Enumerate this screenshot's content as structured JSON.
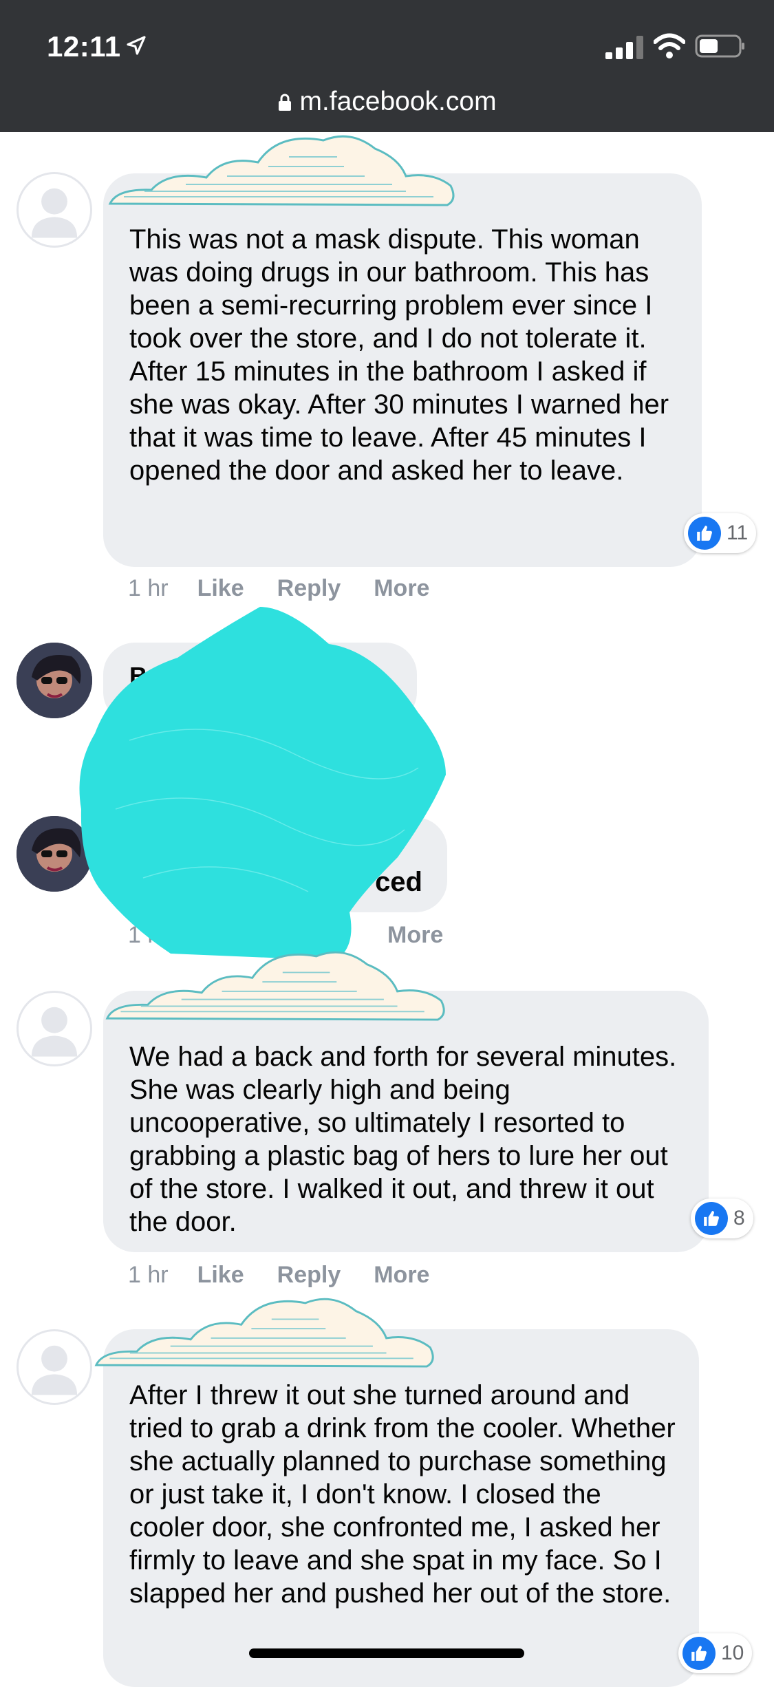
{
  "status_bar": {
    "time": "12:11"
  },
  "browser": {
    "url": "m.facebook.com"
  },
  "comments": [
    {
      "text": "This was not a mask dispute. This woman was doing drugs in our bathroom. This has been a semi-recurring problem ever since I took over the store, and I do not tolerate it. After 15 minutes in the bathroom I asked if she was okay. After 30 minutes I warned her that it was time to leave. After 45 minutes I opened the door and asked her to leave.",
      "time": "1 hr",
      "like": "Like",
      "reply": "Reply",
      "more": "More",
      "reactions": "11"
    },
    {
      "name_partial": "Be",
      "time": "1 hr",
      "more": "More"
    },
    {
      "text_partial": "ced"
    },
    {
      "text": "We had a back and forth for several minutes. She was clearly high and being uncooperative, so ultimately I resorted to grabbing a plastic bag of hers to lure her out of the store. I walked it out, and threw it out the door.",
      "time": "1 hr",
      "like": "Like",
      "reply": "Reply",
      "more": "More",
      "reactions": "8"
    },
    {
      "text": "After I threw it out she turned around and tried to grab a drink from the cooler. Whether she actually planned to purchase something or just take it, I don't know. I closed the cooler door, she confronted me, I asked her firmly to leave and she spat in my face. So I slapped her and pushed her out of the store.",
      "reactions": "10"
    }
  ],
  "colors": {
    "bubble": "#eceef1",
    "like_blue": "#1877f2",
    "redaction": "#2ee0de"
  }
}
